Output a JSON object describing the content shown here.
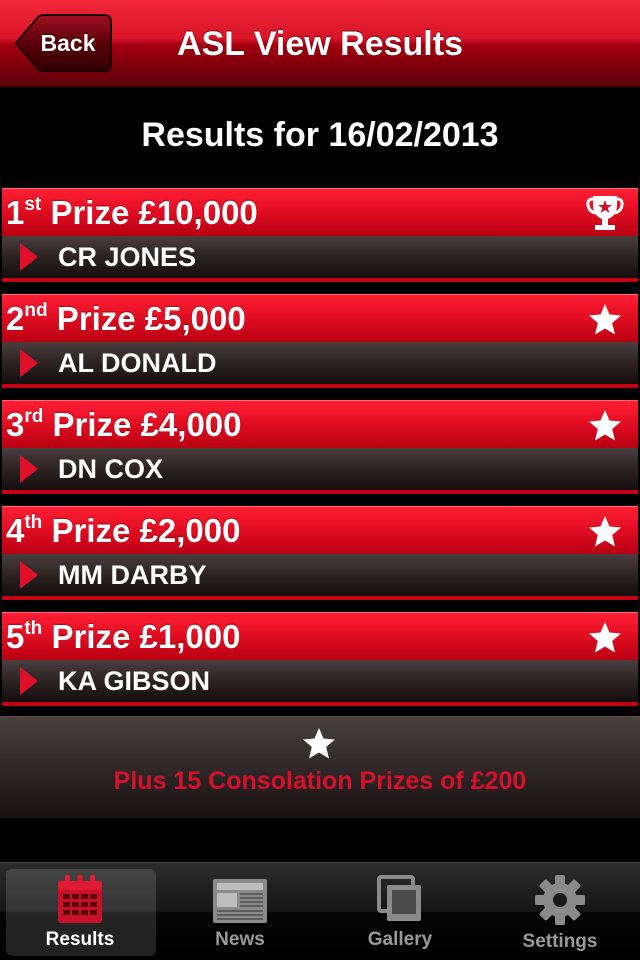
{
  "navbar": {
    "back_label": "Back",
    "title": "ASL View Results"
  },
  "results": {
    "date_title": "Results for 16/02/2013"
  },
  "prizes": [
    {
      "ordinal": "1",
      "suffix": "st",
      "label": "Prize",
      "amount": "£10,000",
      "winner": "CR JONES",
      "icon": "trophy-icon"
    },
    {
      "ordinal": "2",
      "suffix": "nd",
      "label": "Prize",
      "amount": "£5,000",
      "winner": "AL DONALD",
      "icon": "star-icon"
    },
    {
      "ordinal": "3",
      "suffix": "rd",
      "label": "Prize",
      "amount": "£4,000",
      "winner": "DN COX",
      "icon": "star-icon"
    },
    {
      "ordinal": "4",
      "suffix": "th",
      "label": "Prize",
      "amount": "£2,000",
      "winner": "MM DARBY",
      "icon": "star-icon"
    },
    {
      "ordinal": "5",
      "suffix": "th",
      "label": "Prize",
      "amount": "£1,000",
      "winner": "KA GIBSON",
      "icon": "star-icon"
    }
  ],
  "consolation": {
    "text": "Plus 15 Consolation Prizes of £200",
    "icon": "star-icon"
  },
  "tabs": [
    {
      "label": "Results",
      "icon": "calendar-icon",
      "active": true
    },
    {
      "label": "News",
      "icon": "newspaper-icon",
      "active": false
    },
    {
      "label": "Gallery",
      "icon": "gallery-icon",
      "active": false
    },
    {
      "label": "Settings",
      "icon": "gear-icon",
      "active": false
    }
  ],
  "colors": {
    "brand_red": "#e30e23",
    "consolation_text": "#d8102a"
  }
}
